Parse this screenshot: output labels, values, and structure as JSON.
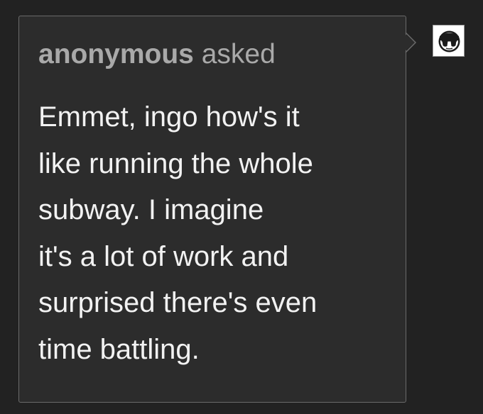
{
  "ask": {
    "asker": "anonymous",
    "verb": "asked",
    "question_lines": [
      "Emmet, ingo how's it",
      "like running the whole",
      "subway. I imagine",
      "it's a lot of work and",
      "surprised there's even",
      "time battling."
    ]
  },
  "avatar": {
    "icon": "sunglasses-face-icon"
  },
  "colors": {
    "page_background": "#222222",
    "bubble_background": "#2c2c2c",
    "bubble_border": "#6a6a6a",
    "asker_text": "#a9a9a9",
    "question_text": "#f2f2f2"
  }
}
